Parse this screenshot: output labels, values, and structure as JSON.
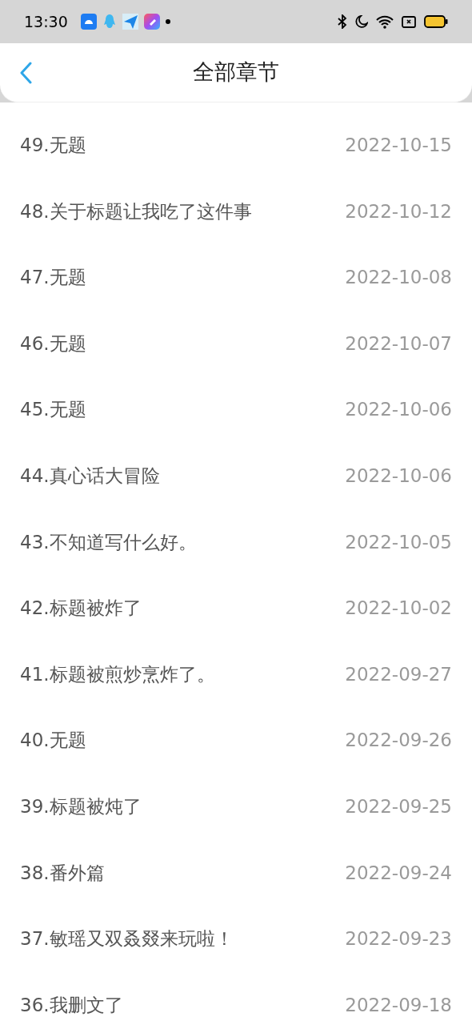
{
  "status_bar": {
    "time": "13:30"
  },
  "header": {
    "title": "全部章节"
  },
  "chapters": [
    {
      "title": "49.无题",
      "date": "2022-10-15"
    },
    {
      "title": "48.关于标题让我吃了这件事",
      "date": "2022-10-12"
    },
    {
      "title": "47.无题",
      "date": "2022-10-08"
    },
    {
      "title": "46.无题",
      "date": "2022-10-07"
    },
    {
      "title": "45.无题",
      "date": "2022-10-06"
    },
    {
      "title": "44.真心话大冒险",
      "date": "2022-10-06"
    },
    {
      "title": "43.不知道写什么好。",
      "date": "2022-10-05"
    },
    {
      "title": "42.标题被炸了",
      "date": "2022-10-02"
    },
    {
      "title": "41.标题被煎炒烹炸了。",
      "date": "2022-09-27"
    },
    {
      "title": "40.无题",
      "date": "2022-09-26"
    },
    {
      "title": "39.标题被炖了",
      "date": "2022-09-25"
    },
    {
      "title": "38.番外篇",
      "date": "2022-09-24"
    },
    {
      "title": "37.敏瑶又双叒叕来玩啦！",
      "date": "2022-09-23"
    },
    {
      "title": "36.我删文了",
      "date": "2022-09-18"
    }
  ]
}
